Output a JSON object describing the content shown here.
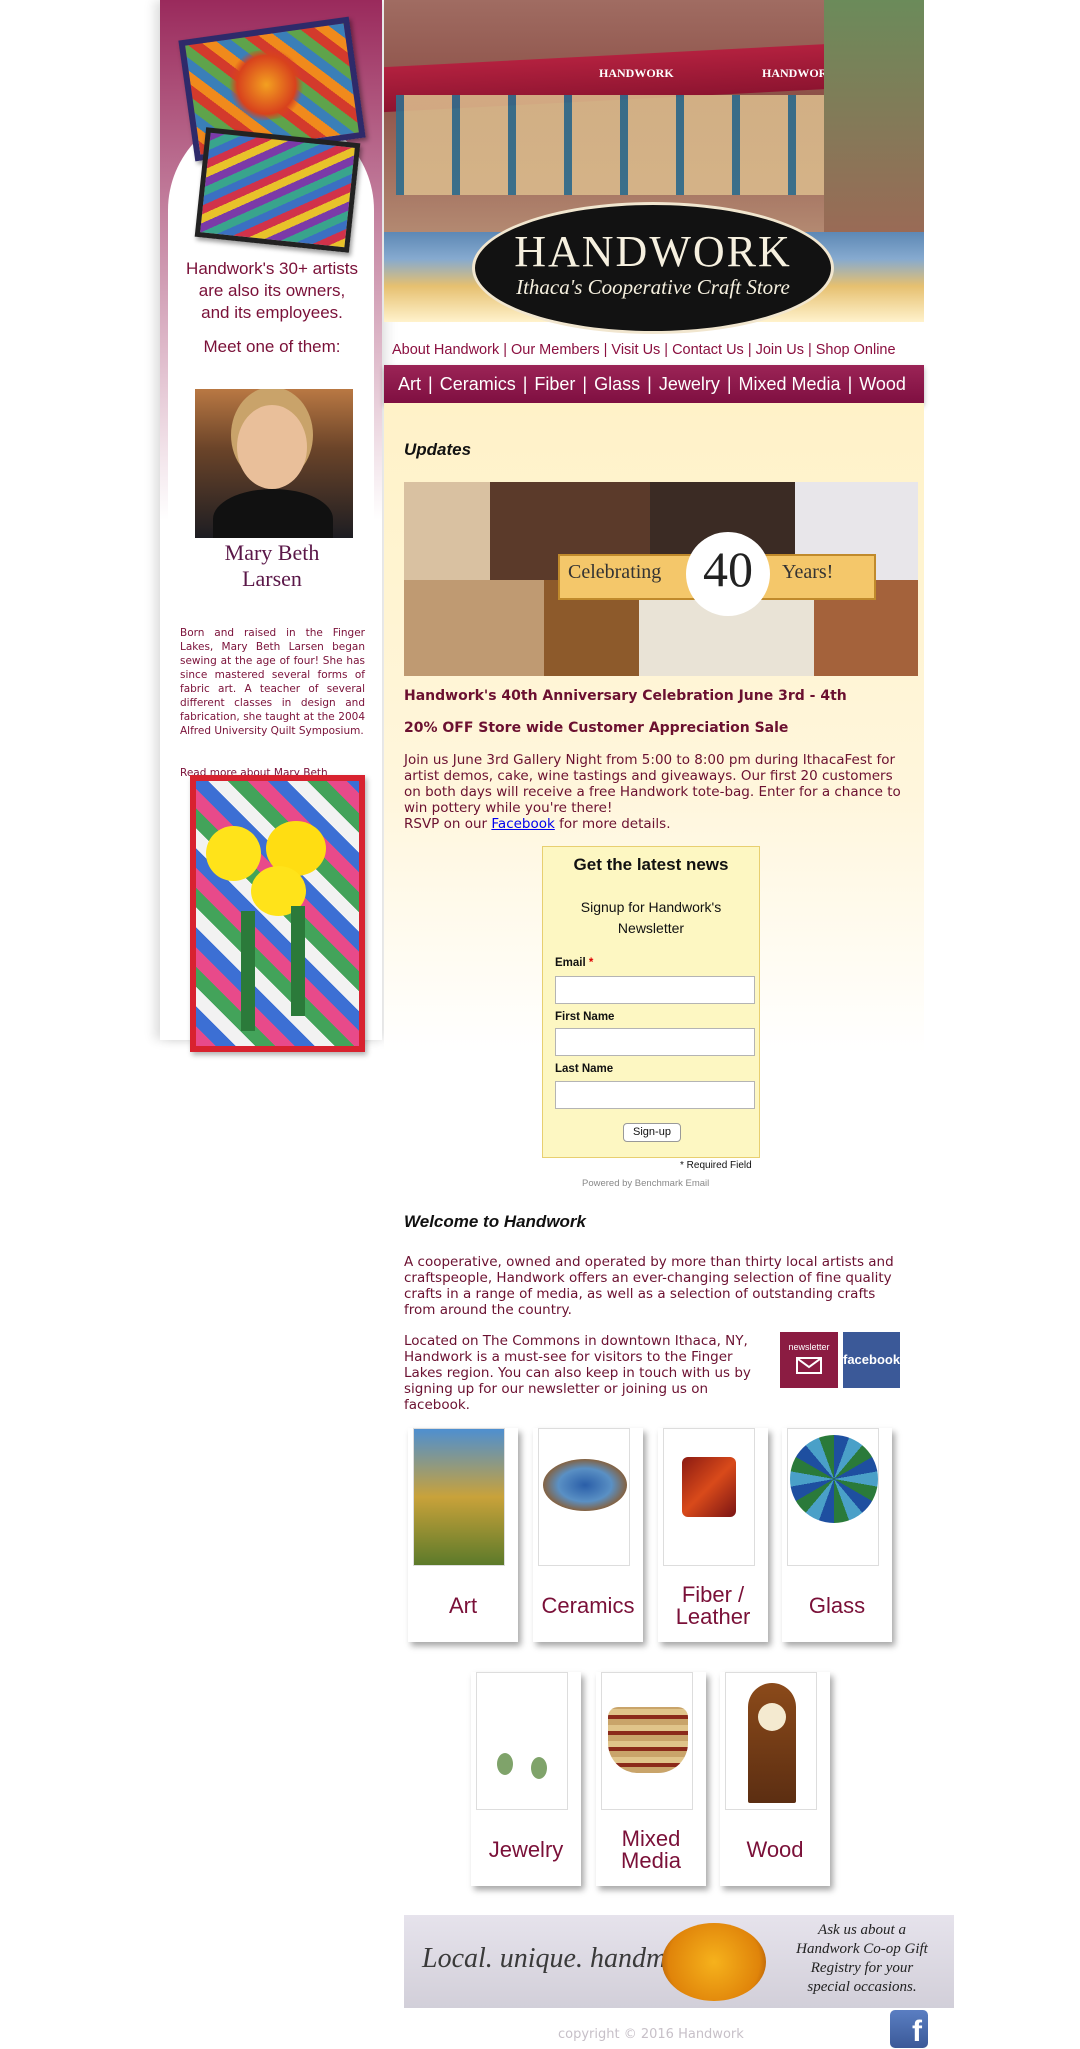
{
  "sidebar": {
    "tagline_1": "Handwork's 30+ artists",
    "tagline_2": "are also its owners,",
    "tagline_3": "and its employees.",
    "meet": "Meet one of them:",
    "member_name_1": "Mary Beth",
    "member_name_2": "Larsen",
    "bio": "Born and raised in the Finger Lakes, Mary Beth Larsen began sewing at the age of four! She has since mastered several forms of fabric art. A teacher of several different classes in design and fabrication, she taught at the 2004 Alfred University Quilt Symposium.",
    "read_more": "Read more about Mary Beth"
  },
  "header": {
    "store_sign_1": "HANDWORK",
    "store_sign_2": "HANDWORK",
    "logo_title": "HANDWORK",
    "logo_subtitle": "Ithaca's Cooperative Craft Store"
  },
  "top_nav": [
    "About Handwork",
    "Our Members",
    "Visit Us",
    "Contact Us",
    "Join Us",
    "Shop Online"
  ],
  "category_nav": [
    "Art",
    "Ceramics",
    "Fiber",
    "Glass",
    "Jewelry",
    "Mixed Media",
    "Wood"
  ],
  "updates": {
    "heading": "Updates",
    "banner_left": "Celebrating",
    "banner_number": "40",
    "banner_right": "Years!",
    "headline_1": "Handwork's 40th Anniversary Celebration June 3rd - 4th",
    "headline_2": "20% OFF Store wide Customer Appreciation Sale",
    "body": "Join us June 3rd Gallery Night from 5:00 to 8:00 pm during IthacaFest for artist demos, cake, wine tastings and giveaways. Our first 20 customers on both days will receive a free Handwork tote-bag. Enter for a chance to win pottery while you're there!",
    "rsvp_prefix": "RSVP on our",
    "rsvp_link": "Facebook",
    "rsvp_suffix": "for more details."
  },
  "newsletter": {
    "title": "Get the latest news",
    "subtitle_1": "Signup for Handwork's",
    "subtitle_2": "Newsletter",
    "email_label": "Email",
    "required_star": "*",
    "first_name_label": "First Name",
    "last_name_label": "Last Name",
    "signup_button": "Sign-up",
    "required_note": "* Required Field",
    "powered_by": "Powered by Benchmark Email"
  },
  "welcome": {
    "heading": "Welcome to Handwork",
    "para1": "A cooperative, owned and operated by more than thirty local artists and craftspeople, Handwork offers an ever-changing selection of fine quality crafts in a range of media, as well as a selection of outstanding crafts from around the country.",
    "para2": "Located on The Commons in downtown Ithaca, NY, Handwork is a must-see for visitors to the Finger Lakes region. You can also keep in touch with us by signing up for our newsletter or joining us on facebook.",
    "newsletter_badge": "newsletter",
    "facebook_badge": "facebook"
  },
  "tiles": {
    "art": "Art",
    "ceramics": "Ceramics",
    "fiber_1": "Fiber /",
    "fiber_2": "Leather",
    "glass": "Glass",
    "jewelry": "Jewelry",
    "mixed_1": "Mixed",
    "mixed_2": "Media",
    "wood": "Wood"
  },
  "gift": {
    "slogan": "Local. unique. handmade.",
    "line1": "Ask us about a",
    "line2": "Handwork Co-op Gift",
    "line3": "Registry for your",
    "line4": "special occasions."
  },
  "footer": {
    "copyright": "copyright © 2016 Handwork"
  },
  "colors": {
    "brand_maroon": "#7f0f41",
    "content_cream": "#fff2c8",
    "facebook_blue": "#3b5998"
  }
}
